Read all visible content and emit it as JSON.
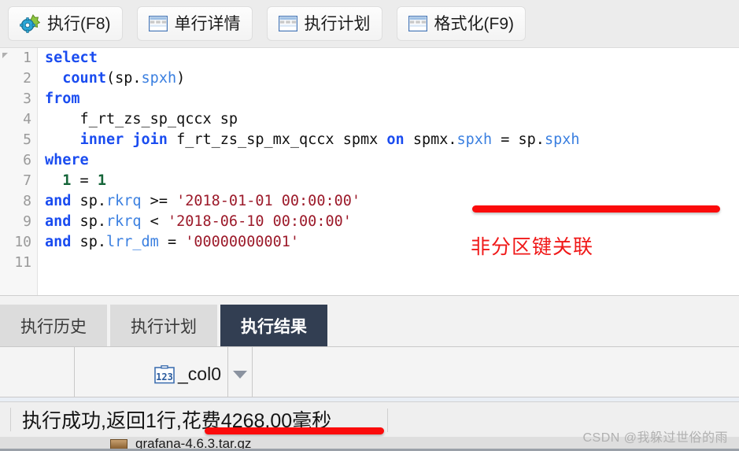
{
  "toolbar": {
    "buttons": [
      {
        "label": "执行(F8)",
        "icon": "run-gear-icon"
      },
      {
        "label": "单行详情",
        "icon": "table-icon"
      },
      {
        "label": "执行计划",
        "icon": "table-icon"
      },
      {
        "label": "格式化(F9)",
        "icon": "table-icon"
      }
    ]
  },
  "editor": {
    "line_numbers": [
      "1",
      "2",
      "3",
      "4",
      "5",
      "6",
      "7",
      "8",
      "9",
      "10",
      "11"
    ],
    "lines": [
      [
        {
          "t": "select",
          "c": "kw"
        }
      ],
      [
        {
          "t": "  ",
          "c": "op"
        },
        {
          "t": "count",
          "c": "kw"
        },
        {
          "t": "(",
          "c": "op"
        },
        {
          "t": "sp",
          "c": "id"
        },
        {
          "t": ".",
          "c": "op"
        },
        {
          "t": "spxh",
          "c": "col"
        },
        {
          "t": ")",
          "c": "op"
        }
      ],
      [
        {
          "t": "from",
          "c": "kw"
        }
      ],
      [
        {
          "t": "    f_rt_zs_sp_qccx sp",
          "c": "id"
        }
      ],
      [
        {
          "t": "    ",
          "c": "op"
        },
        {
          "t": "inner join",
          "c": "kw"
        },
        {
          "t": " f_rt_zs_sp_mx_qccx spmx ",
          "c": "id"
        },
        {
          "t": "on",
          "c": "kw"
        },
        {
          "t": " spmx",
          "c": "id"
        },
        {
          "t": ".",
          "c": "op"
        },
        {
          "t": "spxh",
          "c": "col"
        },
        {
          "t": " = ",
          "c": "op"
        },
        {
          "t": "sp",
          "c": "id"
        },
        {
          "t": ".",
          "c": "op"
        },
        {
          "t": "spxh",
          "c": "col"
        }
      ],
      [
        {
          "t": "where",
          "c": "kw"
        }
      ],
      [
        {
          "t": "  ",
          "c": "op"
        },
        {
          "t": "1",
          "c": "num"
        },
        {
          "t": " = ",
          "c": "op"
        },
        {
          "t": "1",
          "c": "num"
        }
      ],
      [
        {
          "t": "and",
          "c": "kw"
        },
        {
          "t": " sp",
          "c": "id"
        },
        {
          "t": ".",
          "c": "op"
        },
        {
          "t": "rkrq",
          "c": "col"
        },
        {
          "t": " >= ",
          "c": "op"
        },
        {
          "t": "'2018-01-01 00:00:00'",
          "c": "str"
        }
      ],
      [
        {
          "t": "and",
          "c": "kw"
        },
        {
          "t": " sp",
          "c": "id"
        },
        {
          "t": ".",
          "c": "op"
        },
        {
          "t": "rkrq",
          "c": "col"
        },
        {
          "t": " < ",
          "c": "op"
        },
        {
          "t": "'2018-06-10 00:00:00'",
          "c": "str"
        }
      ],
      [
        {
          "t": "and",
          "c": "kw"
        },
        {
          "t": " sp",
          "c": "id"
        },
        {
          "t": ".",
          "c": "op"
        },
        {
          "t": "lrr_dm",
          "c": "col"
        },
        {
          "t": " = ",
          "c": "op"
        },
        {
          "t": "'00000000001'",
          "c": "str"
        }
      ],
      []
    ],
    "annotation": "非分区键关联",
    "annotation_color": "#f01818",
    "underline_color": "#fb0b0b"
  },
  "tabs": [
    {
      "label": "执行历史",
      "active": false
    },
    {
      "label": "执行计划",
      "active": false
    },
    {
      "label": "执行结果",
      "active": true
    }
  ],
  "result_grid": {
    "columns": [
      {
        "name": "_col0",
        "type_icon": "numeric-123-icon"
      }
    ]
  },
  "statusbar": {
    "text": "执行成功,返回1行,花费4268.00毫秒"
  },
  "background_window": {
    "filename": "grafana-4.6.3.tar.gz"
  },
  "watermark": {
    "text": "CSDN @我躲过世俗的雨"
  }
}
